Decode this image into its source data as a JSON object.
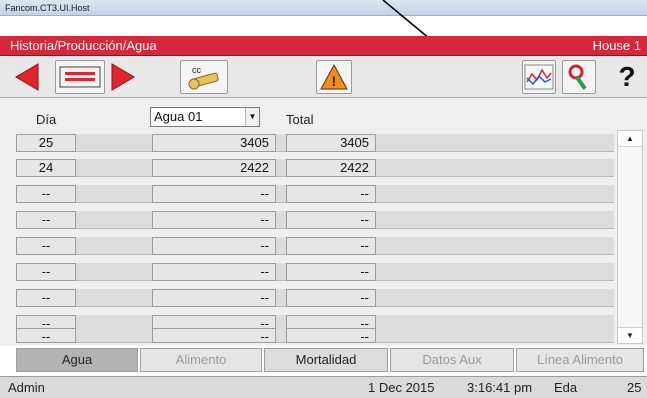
{
  "window": {
    "title": "Fancom.CT3.UI.Host"
  },
  "header": {
    "breadcrumb": "Historia/Producción/Agua",
    "house": "House 1"
  },
  "toolbar": {
    "cc_label": "cc",
    "buttons": [
      "prev-arrow-icon",
      "record-book-icon",
      "next-arrow-icon",
      "key-cc-icon",
      "warning-icon",
      "graph-icon",
      "tool-icon",
      "help-icon"
    ],
    "help_label": "?",
    "warning_label": "!"
  },
  "table": {
    "col_day": "Día",
    "select_value": "Agua 01",
    "col_total": "Total",
    "rows": [
      {
        "day": "25",
        "value": "3405",
        "total": "3405"
      },
      {
        "day": "24",
        "value": "2422",
        "total": "2422"
      },
      {
        "day": "--",
        "value": "--",
        "total": "--"
      },
      {
        "day": "--",
        "value": "--",
        "total": "--"
      },
      {
        "day": "--",
        "value": "--",
        "total": "--"
      },
      {
        "day": "--",
        "value": "--",
        "total": "--"
      },
      {
        "day": "--",
        "value": "--",
        "total": "--"
      },
      {
        "day": "--",
        "value": "--",
        "total": "--"
      },
      {
        "day": "--",
        "value": "--",
        "total": "--"
      }
    ]
  },
  "tabs": [
    {
      "label": "Agua",
      "state": "active"
    },
    {
      "label": "Alimento",
      "state": "disabled"
    },
    {
      "label": "Mortalidad",
      "state": "normal"
    },
    {
      "label": "Datos Aux",
      "state": "disabled"
    },
    {
      "label": "Línea Alimento",
      "state": "disabled"
    }
  ],
  "status": {
    "user": "Admin",
    "date": "1 Dec 2015",
    "time": "3:16:41 pm",
    "age_label": "Eda",
    "age": "25"
  },
  "colors": {
    "header_red": "#d6283a",
    "arrow_red": "#e2242c",
    "warning_orange": "#f28c1c"
  }
}
